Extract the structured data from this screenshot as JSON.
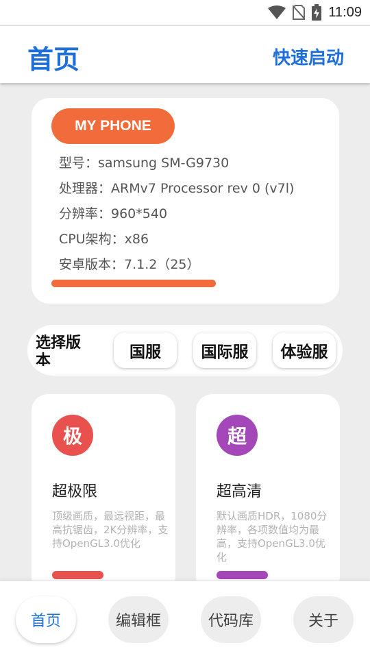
{
  "status": {
    "time": "11:09",
    "icons": [
      "wifi-icon",
      "no-sim-icon",
      "battery-charging-icon"
    ]
  },
  "appbar": {
    "title": "首页",
    "action": "快速启动"
  },
  "phone": {
    "badge": "MY PHONE",
    "specs": [
      "型号：samsung SM-G9730",
      "处理器：ARMv7 Processor rev 0 (v7l)",
      "分辨率：960*540",
      "CPU架构：x86",
      "安卓版本：7.1.2（25）"
    ]
  },
  "version": {
    "label": "选择版本",
    "options": [
      "国服",
      "国际服",
      "体验服"
    ]
  },
  "modes": [
    {
      "icon_char": "极",
      "title": "超极限",
      "desc": "顶级画质，最远视距，最高抗锯齿，2K分辨率，支持OpenGL3.0优化",
      "color": "#e8514e"
    },
    {
      "icon_char": "超",
      "title": "超高清",
      "desc": "默认画质HDR，1080分辨率，各项数值均为最高，支持OpenGL3.0优化",
      "color": "#a447b8"
    }
  ],
  "nav": {
    "items": [
      "首页",
      "编辑框",
      "代码库",
      "关于"
    ],
    "active": "首页"
  },
  "colors": {
    "accent": "#1e6fd9",
    "orange": "#f26b3a"
  }
}
